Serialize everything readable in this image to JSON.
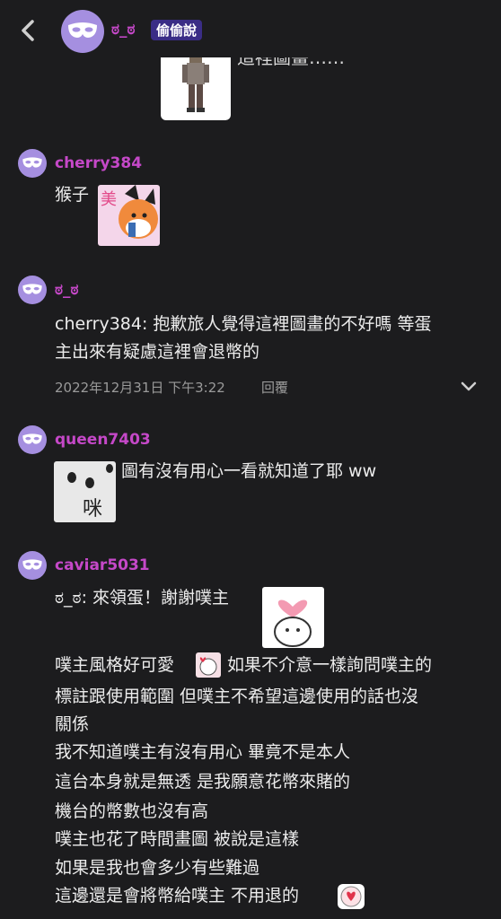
{
  "header": {
    "username": "ಠ_ಠ",
    "badge": "偷偷說"
  },
  "top_post": {
    "cut_text": "這裡圖畫……"
  },
  "comments": [
    {
      "username": "cherry384",
      "text": "猴子"
    },
    {
      "username": "ಠ_ಠ",
      "lines": [
        "cherry384: 抱歉旅人覺得這裡圖畫的不好嗎 等蛋",
        "主出來有疑慮這裡會退幣的"
      ],
      "timestamp": "2022年12月31日 下午3:22",
      "reply_label": "回覆"
    },
    {
      "username": "queen7403",
      "text": "圖有沒有用心一看就知道了耶 ww"
    },
    {
      "username": "caviar5031",
      "lines": [
        "ಠ_ಠ: 來領蛋！謝謝噗主",
        "噗主風格好可愛",
        "如果不介意一樣詢問噗主的",
        "標註跟使用範圍 但噗主不希望這邊使用的話也沒",
        "關係",
        "我不知道噗主有沒有用心 畢竟不是本人",
        "這台本身就是無透 是我願意花幣來賭的",
        "機台的幣數也沒有高",
        "噗主也花了時間畫圖 被說是這樣",
        "如果是我也會多少有些難過",
        "這邊還是會將幣給噗主 不用退的"
      ]
    }
  ],
  "colors": {
    "background": "#1c1c1e",
    "username": "#c548c8",
    "avatar": "#a58fe0",
    "badge_bg": "#3a2d86"
  },
  "icons": {
    "back": "chevron-left-icon",
    "avatar": "mask-icon",
    "expand": "chevron-down-icon"
  }
}
